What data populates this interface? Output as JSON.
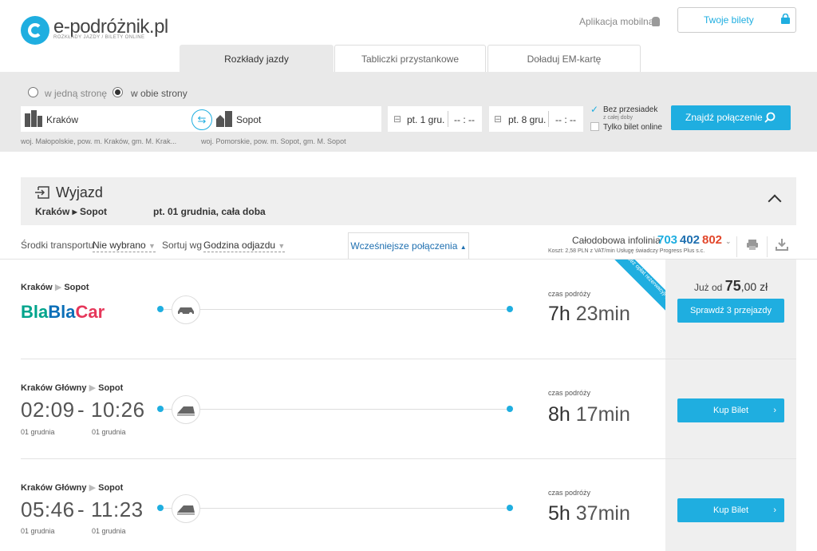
{
  "header": {
    "logo_text": "e-podróżnik.pl",
    "logo_sub": "ROZKŁADY JAZDY / BILETY ONLINE",
    "mobile_app": "Aplikacja mobilna",
    "tickets_button": "Twoje bilety"
  },
  "tabs": [
    {
      "label": "Rozkłady jazdy",
      "active": true
    },
    {
      "label": "Tabliczki przystankowe",
      "active": false
    },
    {
      "label": "Doładuj EM-kartę",
      "active": false
    }
  ],
  "search": {
    "one_way": "w jedną stronę",
    "round_trip": "w obie strony",
    "from": "Kraków",
    "to": "Sopot",
    "from_hint": "woj. Małopolskie, pow. m. Kraków, gm. M. Krak...",
    "to_hint": "woj. Pomorskie, pow. m. Sopot, gm. M. Sopot",
    "date_out": "pt. 1 gru.",
    "time_out": "-- : --",
    "date_back": "pt. 8 gru.",
    "time_back": "-- : --",
    "no_transfers": "Bez przesiadek",
    "no_transfers_sub": "z całej doby",
    "online_only": "Tylko bilet online",
    "search_button": "Znajdź połączenie"
  },
  "departure": {
    "title": "Wyjazd",
    "route": "Kraków ▸ Sopot",
    "date": "pt. 01 grudnia, cała doba"
  },
  "filters": {
    "transport_label": "Środki transportu",
    "transport_value": "Nie wybrano",
    "sort_label": "Sortuj wg",
    "sort_value": "Godzina odjazdu",
    "earlier": "Wcześniejsze połączenia",
    "infoline_label": "Całodobowa infolinia",
    "infoline_p1": "703",
    "infoline_p2": "402",
    "infoline_p3": "802",
    "infoline_cost": "Koszt: 2,58 PLN z VAT/min Usługę świadczy Progress Plus s.c."
  },
  "results": [
    {
      "from": "Kraków",
      "to": "Sopot",
      "carrier": "BlaBlaCar",
      "ribbon": "Bez opłat rezerwacyjnych",
      "duration_label": "czas podróży",
      "duration_h": "7h",
      "duration_m": "23min",
      "price_prefix": "Już od",
      "price_main": "75",
      "price_rest": ",00 zł",
      "button": "Sprawdź 3 przejazdy"
    },
    {
      "from": "Kraków Główny",
      "to": "Sopot",
      "dep_time": "02:09",
      "arr_time": "10:26",
      "dep_date": "01 grudnia",
      "arr_date": "01 grudnia",
      "duration_label": "czas podróży",
      "duration_h": "8h",
      "duration_m": "17min",
      "button": "Kup Bilet"
    },
    {
      "from": "Kraków Główny",
      "to": "Sopot",
      "dep_time": "05:46",
      "arr_time": "11:23",
      "dep_date": "01 grudnia",
      "arr_date": "01 grudnia",
      "duration_label": "czas podróży",
      "duration_h": "5h",
      "duration_m": "37min",
      "button": "Kup Bilet"
    }
  ],
  "colors": {
    "accent": "#1faee0",
    "band": "#e9e9e9",
    "infoline_red": "#e2472b",
    "infoline_blue": "#1e6fb0"
  }
}
